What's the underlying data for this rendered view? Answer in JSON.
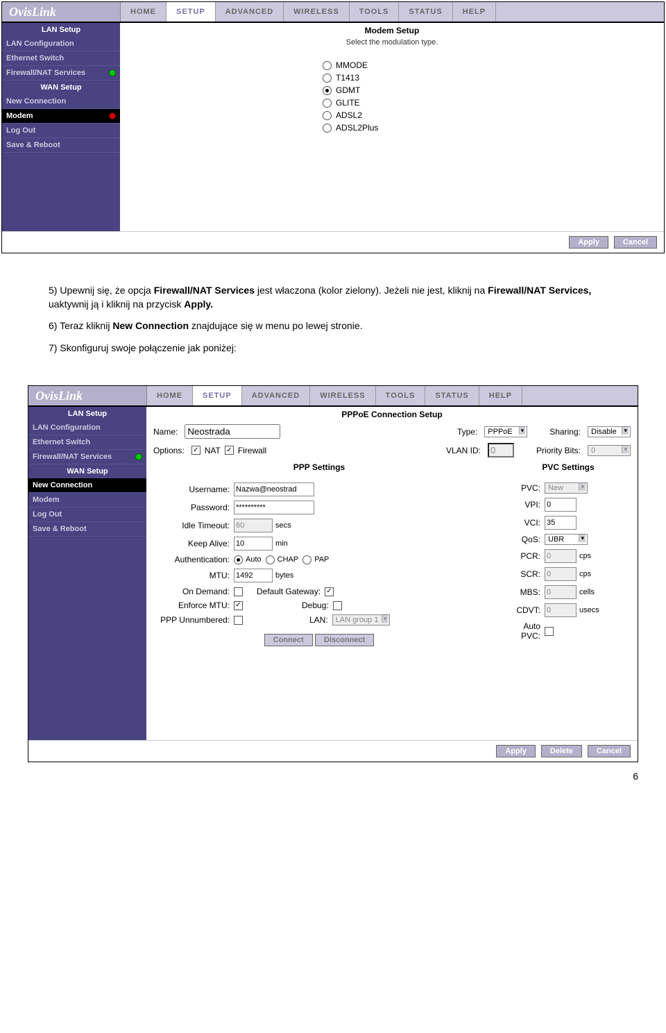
{
  "logo": "OvisLink",
  "nav": {
    "home": "HOME",
    "setup": "SETUP",
    "advanced": "ADVANCED",
    "wireless": "WIRELESS",
    "tools": "TOOLS",
    "status": "STATUS",
    "help": "HELP"
  },
  "sidebar1": {
    "lan_setup": "LAN Setup",
    "lan_conf": "LAN Configuration",
    "eth_switch": "Ethernet Switch",
    "firewall": "Firewall/NAT Services",
    "wan_setup": "WAN Setup",
    "new_conn": "New Connection",
    "modem": "Modem",
    "log_out": "Log Out",
    "save_reboot": "Save & Reboot"
  },
  "modem_panel": {
    "title": "Modem Setup",
    "subtitle": "Select the modulation type.",
    "options": {
      "mmode": "MMODE",
      "t1413": "T1413",
      "gdmt": "GDMT",
      "glite": "GLITE",
      "adsl2": "ADSL2",
      "adsl2plus": "ADSL2Plus"
    }
  },
  "buttons": {
    "apply": "Apply",
    "cancel": "Cancel",
    "delete": "Delete",
    "connect": "Connect",
    "disconnect": "Disconnect"
  },
  "doc": {
    "p5_a": "5)  Upewnij się, że opcja ",
    "p5_b": "Firewall/NAT Services",
    "p5_c": " jest właczona (kolor zielony). Jeżeli nie jest, kliknij na ",
    "p5_d": "Firewall/NAT Services,",
    "p5_e": " uaktywnij ją i kliknij na przycisk ",
    "p5_f": "Apply.",
    "p6_a": "6)  Teraz kliknij ",
    "p6_b": "New Connection",
    "p6_c": " znajdujące się w menu po lewej stronie.",
    "p7": "7)  Skonfiguruj swoje połączenie jak poniżej:"
  },
  "pppoe": {
    "title": "PPPoE Connection Setup",
    "name_label": "Name:",
    "name_value": "Neostrada",
    "type_label": "Type:",
    "type_value": "PPPoE",
    "sharing_label": "Sharing:",
    "sharing_value": "Disable",
    "options_label": "Options:",
    "nat_label": "NAT",
    "firewall_label": "Firewall",
    "vlan_label": "VLAN ID:",
    "vlan_value": "0",
    "priority_label": "Priority Bits:",
    "priority_value": "0",
    "ppp_settings": "PPP Settings",
    "pvc_settings": "PVC Settings",
    "username_label": "Username:",
    "username_value": "Nazwa@neostrad",
    "password_label": "Password:",
    "password_value": "**********",
    "idle_label": "Idle Timeout:",
    "idle_value": "60",
    "secs": "secs",
    "keepalive_label": "Keep Alive:",
    "keepalive_value": "10",
    "min": "min",
    "auth_label": "Authentication:",
    "auth_auto": "Auto",
    "auth_chap": "CHAP",
    "auth_pap": "PAP",
    "mtu_label": "MTU:",
    "mtu_value": "1492",
    "bytes": "bytes",
    "ondemand_label": "On Demand:",
    "defgw_label": "Default Gateway:",
    "enforce_label": "Enforce MTU:",
    "debug_label": "Debug:",
    "unnumbered_label": "PPP Unnumbered:",
    "lan_label": "LAN:",
    "lan_value": "LAN group 1",
    "pvc_label": "PVC:",
    "pvc_value": "New",
    "vpi_label": "VPI:",
    "vpi_value": "0",
    "vci_label": "VCI:",
    "vci_value": "35",
    "qos_label": "QoS:",
    "qos_value": "UBR",
    "pcr_label": "PCR:",
    "pcr_value": "0",
    "cps": "cps",
    "scr_label": "SCR:",
    "scr_value": "0",
    "mbs_label": "MBS:",
    "mbs_value": "0",
    "cells": "cells",
    "cdvt_label": "CDVT:",
    "cdvt_value": "0",
    "usecs": "usecs",
    "autopvc_label": "Auto PVC:"
  },
  "page_number": "6"
}
